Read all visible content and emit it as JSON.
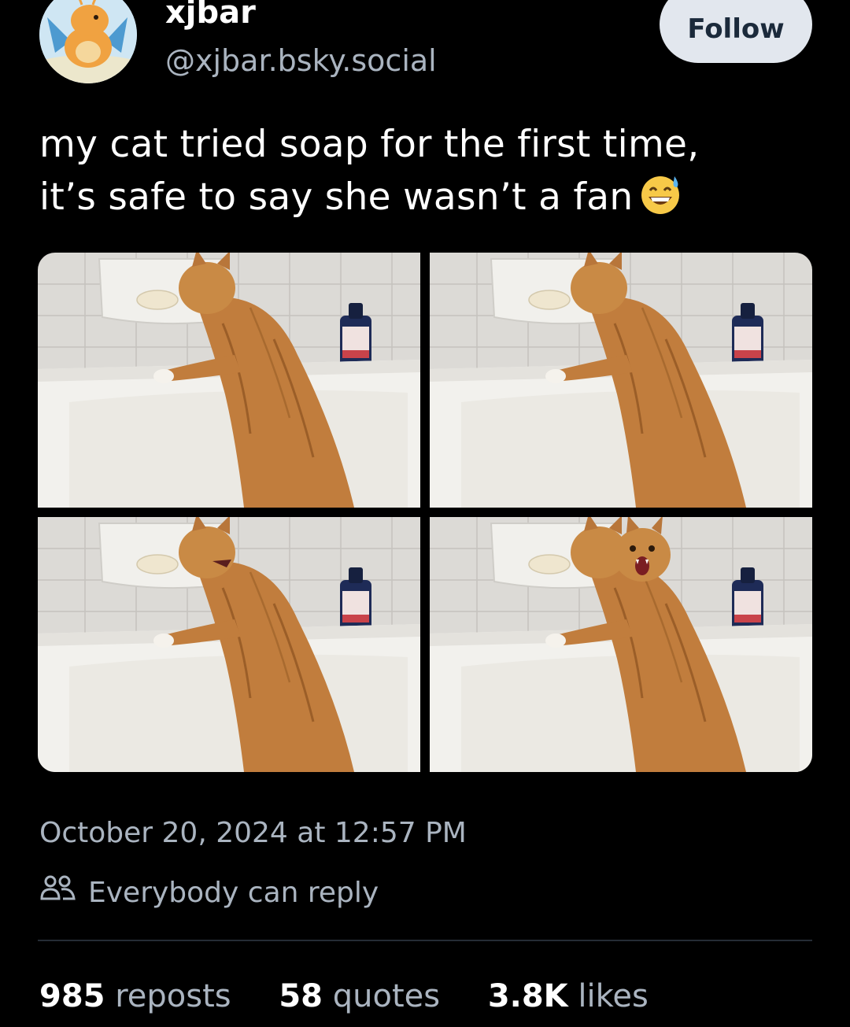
{
  "author": {
    "display_name": "xjbar",
    "handle": "@xjbar.bsky.social"
  },
  "follow_button": {
    "label": "Follow"
  },
  "post": {
    "text_line1": "my cat tried soap for the first time,",
    "text_line2": "it’s safe to say she wasn’t a fan",
    "emoji": "grinning-face-with-sweat-icon",
    "image_count": 4
  },
  "timestamp": "October 20, 2024 at 12:57 PM",
  "reply_setting": {
    "icon": "people-icon",
    "label": "Everybody can reply"
  },
  "stats": {
    "reposts_count": "985",
    "reposts_label": "reposts",
    "quotes_count": "58",
    "quotes_label": "quotes",
    "likes_count": "3.8K",
    "likes_label": "likes"
  },
  "colors": {
    "background": "#000000",
    "text_primary": "#ffffff",
    "text_secondary": "#aab4c0",
    "follow_button_bg": "#e2e7ee",
    "follow_button_text": "#1b2a3b",
    "divider": "#252c35"
  }
}
